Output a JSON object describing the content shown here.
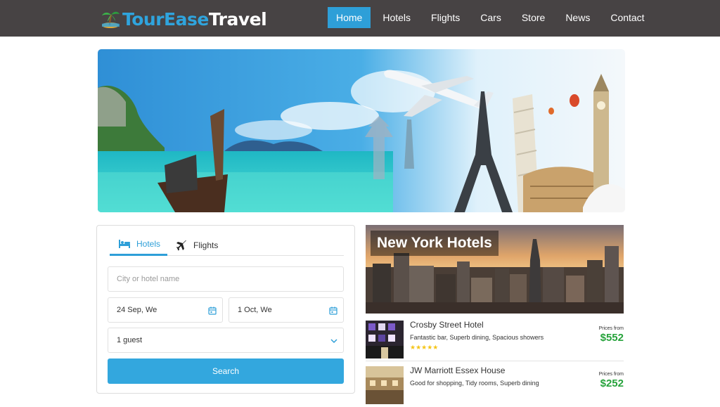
{
  "brand": {
    "part1": "TourEase",
    "part2": "Travel"
  },
  "nav": {
    "items": [
      {
        "label": "Home",
        "active": true
      },
      {
        "label": "Hotels"
      },
      {
        "label": "Flights"
      },
      {
        "label": "Cars"
      },
      {
        "label": "Store"
      },
      {
        "label": "News"
      },
      {
        "label": "Contact"
      }
    ]
  },
  "search": {
    "tabs": {
      "hotels": "Hotels",
      "flights": "Flights"
    },
    "city_placeholder": "City or hotel name",
    "checkin": "24 Sep, We",
    "checkout": "1 Oct, We",
    "guests": "1 guest",
    "button": "Search"
  },
  "hotels": {
    "city_title": "New York Hotels",
    "list": [
      {
        "name": "Crosby Street Hotel",
        "desc": "Fantastic bar, Superb dining, Spacious showers",
        "stars": "★★★★★",
        "rating": 5,
        "prices_from": "Prices from",
        "price": "$552"
      },
      {
        "name": "JW Marriott Essex House",
        "desc": "Good for shopping, Tidy rooms, Superb dining",
        "prices_from": "Prices from",
        "price": "$252"
      }
    ]
  },
  "colors": {
    "nav_bg": "#474344",
    "accent": "#2e9fd8",
    "price": "#27a33c",
    "star": "#f5c518"
  }
}
